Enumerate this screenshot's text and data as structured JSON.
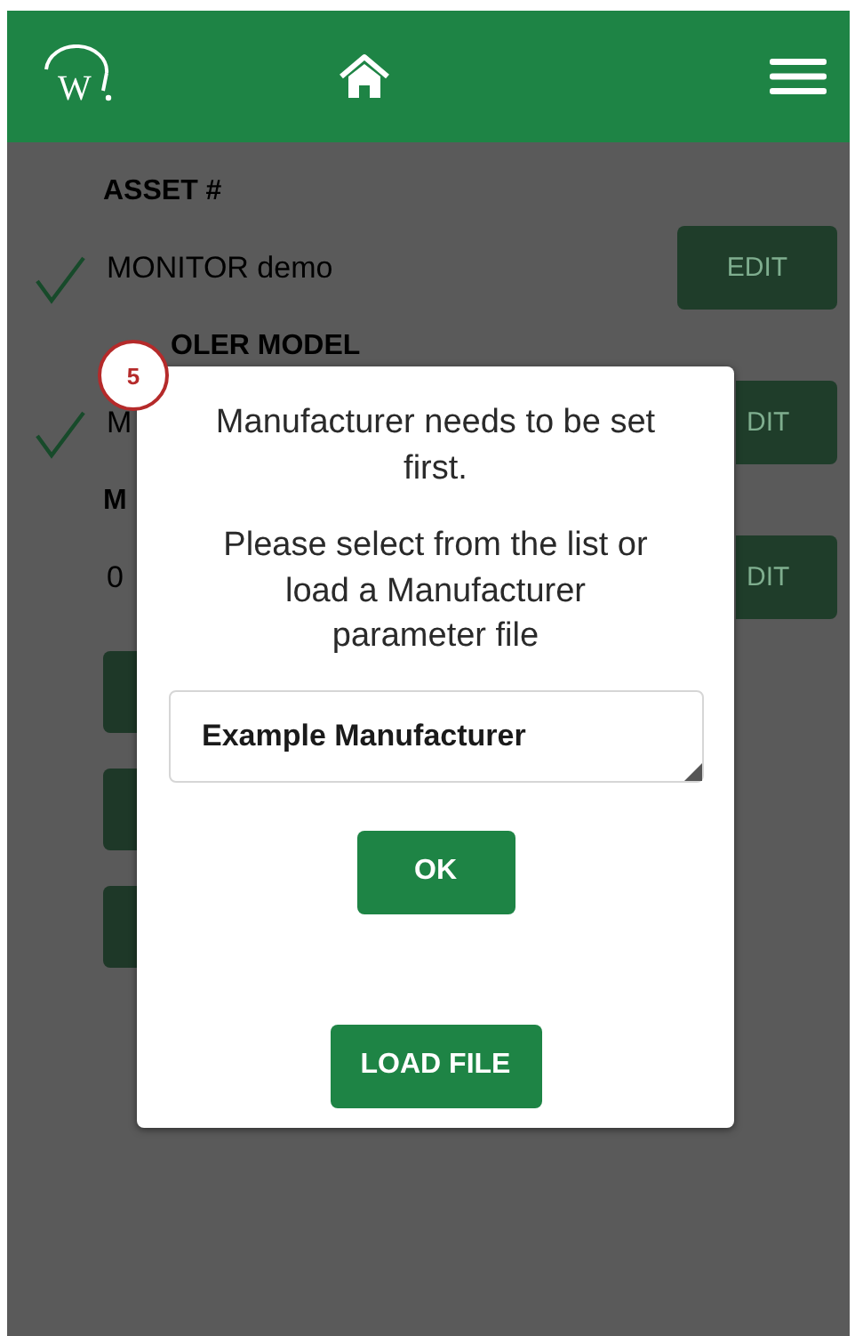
{
  "header": {
    "logo_text": "W"
  },
  "form": {
    "sections": [
      {
        "label": "ASSET #",
        "value": "MONITOR demo",
        "checked": true,
        "edit_button": "EDIT"
      },
      {
        "label": "OLER MODEL",
        "value": "M",
        "checked": true,
        "edit_button": "DIT"
      },
      {
        "label": "M",
        "value": "0",
        "checked": false,
        "edit_button": "DIT"
      }
    ]
  },
  "dialog": {
    "badge": "5",
    "message": "Manufacturer needs to be set first.",
    "instruction": "Please select from the list or load a Manufacturer parameter file",
    "select": {
      "value": "Example Manufacturer"
    },
    "buttons": [
      {
        "label": "OK"
      },
      {
        "label": "LOAD FILE"
      }
    ]
  }
}
